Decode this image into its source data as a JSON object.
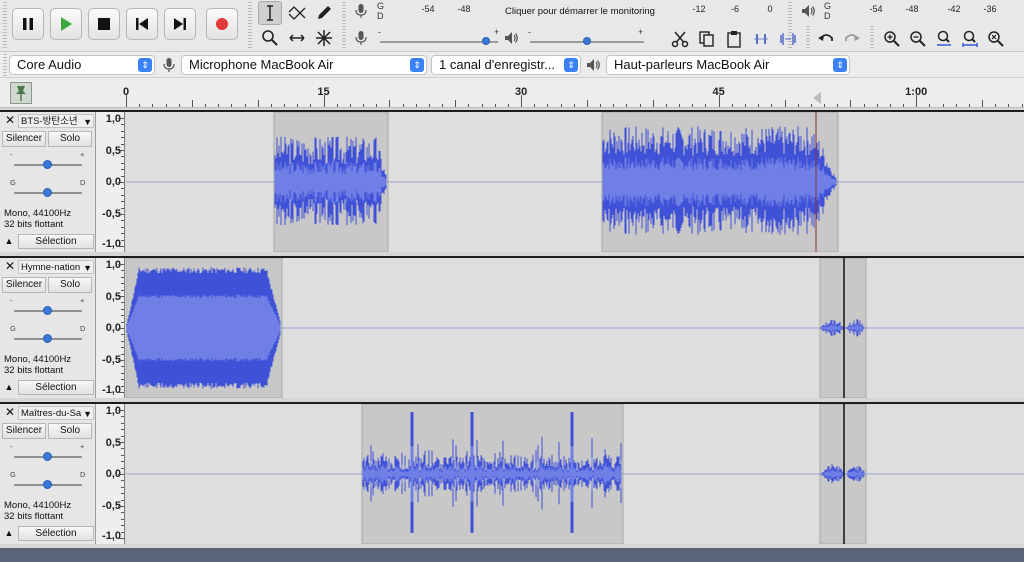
{
  "toolbar": {
    "transport": [
      "pause-icon",
      "play-icon",
      "stop-icon",
      "skip-to-start-icon",
      "skip-to-end-icon",
      "record-icon"
    ],
    "tools": [
      "selection-tool-icon",
      "envelope-tool-icon",
      "draw-tool-icon",
      "zoom-tool-icon",
      "timeshift-tool-icon",
      "multi-tool-icon"
    ],
    "record_meter": {
      "gd_g": "G",
      "gd_d": "D",
      "ticks": [
        "-54",
        "-48",
        "-12",
        "-6",
        "0"
      ],
      "monitor_label": "Cliquer pour démarrer le monitoring"
    },
    "play_meter": {
      "gd_g": "G",
      "gd_d": "D",
      "ticks": [
        "-54",
        "-48",
        "-42",
        "-36"
      ]
    },
    "mixer": {
      "minus": "-",
      "plus": "+",
      "record_volume": 0.9,
      "playback_volume": 0.5
    },
    "edit": [
      "cut-icon",
      "copy-icon",
      "paste-icon",
      "trim-icon",
      "silence-icon"
    ],
    "undo_redo": [
      "undo-icon",
      "redo-icon"
    ],
    "zoom": [
      "zoom-in-icon",
      "zoom-out-icon",
      "fit-selection-icon",
      "fit-project-icon",
      "zoom-toggle-icon"
    ]
  },
  "devices": {
    "host": "Core Audio",
    "record_device": "Microphone MacBook Air",
    "channels": "1 canal d'enregistr...",
    "playback_device": "Haut-parleurs MacBook Air"
  },
  "timeline": {
    "labels": [
      "0",
      "15",
      "30",
      "45",
      "1:00"
    ],
    "values_sec": [
      0,
      15,
      30,
      45,
      60
    ]
  },
  "tracks": [
    {
      "name": "BTS-방탄소년",
      "mute": "Silencer",
      "solo": "Solo",
      "gain_g": "G",
      "gain_d": "D",
      "gain_minus": "-",
      "gain_plus": "+",
      "info1": "Mono, 44100Hz",
      "info2": "32 bits flottant",
      "select": "Sélection",
      "scale": [
        "1,0",
        "0,5",
        "0,0",
        "-0,5",
        "-1,0"
      ]
    },
    {
      "name": "Hymne-nation",
      "mute": "Silencer",
      "solo": "Solo",
      "gain_g": "G",
      "gain_d": "D",
      "gain_minus": "-",
      "gain_plus": "+",
      "info1": "Mono, 44100Hz",
      "info2": "32 bits flottant",
      "select": "Sélection",
      "scale": [
        "1,0",
        "0,5",
        "0,0",
        "-0,5",
        "-1,0"
      ]
    },
    {
      "name": "Maîtres-du-Sa",
      "mute": "Silencer",
      "solo": "Solo",
      "gain_g": "G",
      "gain_d": "D",
      "gain_minus": "-",
      "gain_plus": "+",
      "info1": "Mono, 44100Hz",
      "info2": "32 bits flottant",
      "select": "Sélection",
      "scale": [
        "1,0",
        "0,5",
        "0,0",
        "-0,5",
        "-1,0"
      ]
    }
  ],
  "colors": {
    "wave": "#3f51d6",
    "wave_rms": "#6f7fe6",
    "clip_bg": "#c8c8c8",
    "accent": "#3b82f6",
    "record": "#e03a3a",
    "play": "#3aa83a"
  }
}
